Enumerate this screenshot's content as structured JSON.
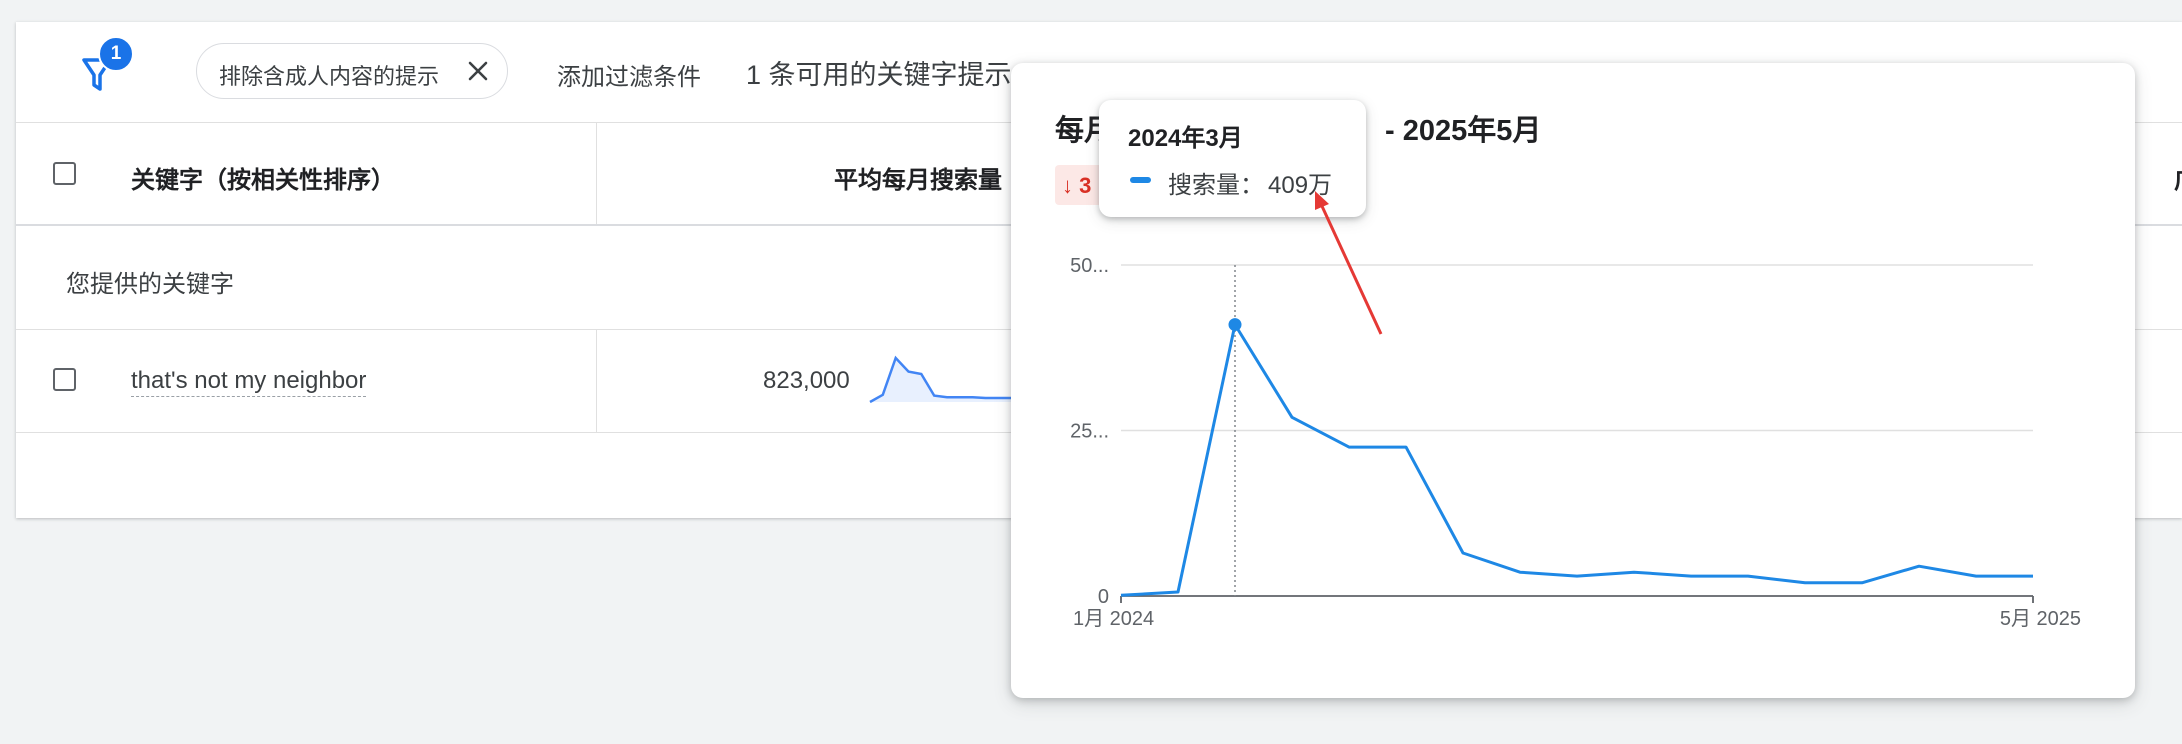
{
  "filter_bar": {
    "filter_count": "1",
    "chip_label": "排除含成人内容的提示",
    "add_filter_label": "添加过滤条件",
    "ideas_count_label": "1 条可用的关键字提示"
  },
  "table": {
    "header": {
      "keyword_col": "关键字（按相关性排序）",
      "volume_col": "平均每月搜索量",
      "cut_col": "广"
    },
    "group_label": "您提供的关键字",
    "rows": [
      {
        "keyword": "that's not my neighbor",
        "volume": "823,000",
        "trend": [
          0,
          0.9,
          5.5,
          3.8,
          3.5,
          0.8,
          0.6,
          0.6,
          0.6,
          0.5,
          0.5,
          0.5,
          0.5
        ]
      }
    ]
  },
  "popup": {
    "title_left": "每月",
    "title_right": "- 2025年5月",
    "trend_arrow": "↓",
    "trend_digit": "3"
  },
  "tooltip": {
    "date": "2024年3月",
    "series_label": "搜索量：",
    "value": "409万"
  },
  "chart_data": {
    "type": "line",
    "series": [
      {
        "values": [
          0.1,
          0.6,
          41,
          27,
          22.5,
          22.5,
          6.5,
          3.6,
          3,
          3.6,
          3,
          3,
          2,
          2,
          4.5,
          3,
          3
        ]
      }
    ],
    "x_start_label": "1月 2024",
    "x_end_label": "5月 2025",
    "y_tick_labels": [
      "0",
      "25...",
      "50..."
    ],
    "y_ticks": [
      0,
      25,
      50
    ],
    "ylim": [
      0,
      50
    ],
    "highlight_index": 2,
    "grid": true,
    "colors": {
      "line": "#1e88e5",
      "annotation_arrow": "#e53935"
    }
  }
}
